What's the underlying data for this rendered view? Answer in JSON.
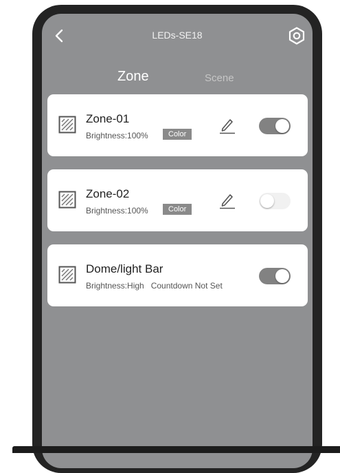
{
  "header": {
    "title": "LEDs-SE18",
    "back_icon": "chevron-left-icon",
    "settings_icon": "gear-icon"
  },
  "tabs": [
    {
      "label": "Zone",
      "active": true
    },
    {
      "label": "Scene",
      "active": false
    }
  ],
  "zones": [
    {
      "name": "Zone-01",
      "detail": "Brightness:100%",
      "color_label": "Color",
      "enabled": true,
      "icon": "zone-pattern-icon"
    },
    {
      "name": "Zone-02",
      "detail": "Brightness:100%",
      "color_label": "Color",
      "enabled": false,
      "icon": "zone-pattern-icon"
    },
    {
      "name": "Dome/light Bar",
      "detail": "Brightness:High   Countdown Not Set",
      "enabled": true,
      "icon": "zone-pattern-icon"
    }
  ],
  "colors": {
    "screen_bg": "#8f9092",
    "toggle_on": "#828282",
    "toggle_off": "#f1f1f1"
  }
}
